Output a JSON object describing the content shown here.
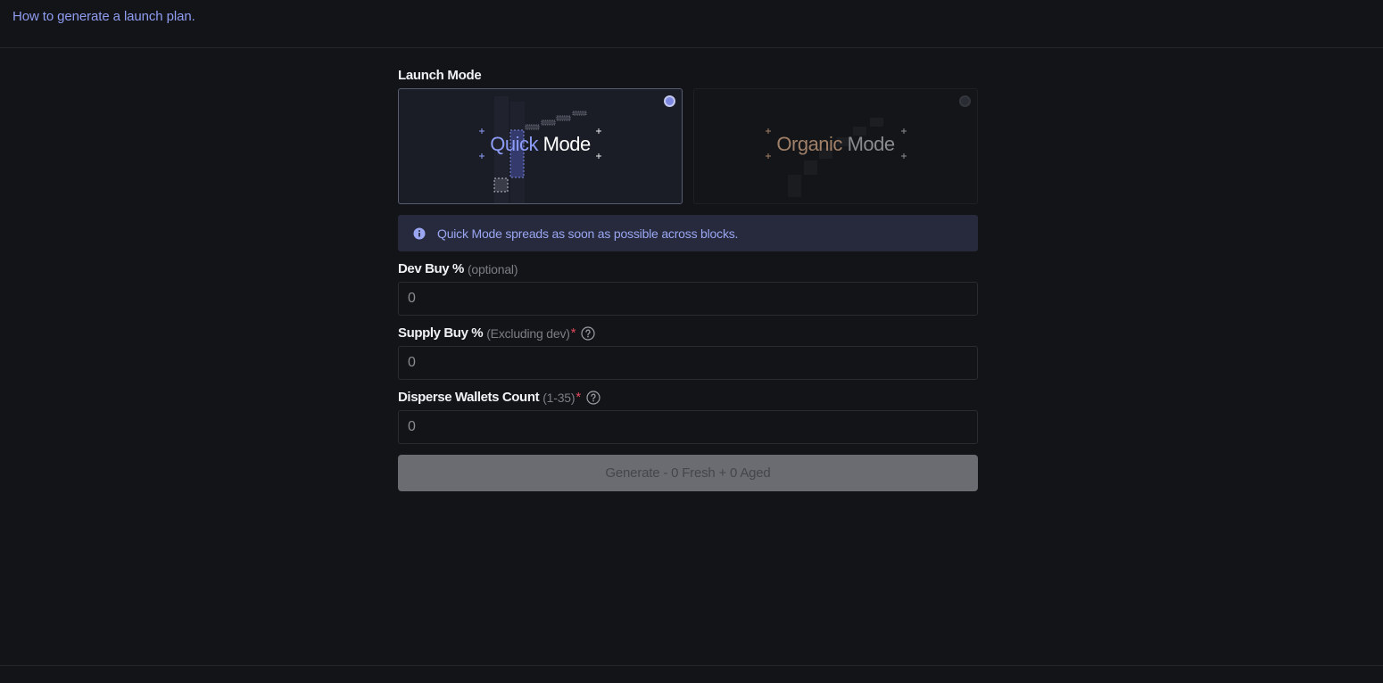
{
  "header": {
    "help_link": "How to generate a launch plan."
  },
  "launch_mode": {
    "label": "Launch Mode",
    "modes": [
      {
        "word1": "Quick",
        "word2": "Mode",
        "selected": true,
        "accent": "#8d9cf6"
      },
      {
        "word1": "Organic",
        "word2": "Mode",
        "selected": false,
        "accent": "#a08068"
      }
    ]
  },
  "info": {
    "icon": "info-icon",
    "text": "Quick Mode spreads as soon as possible across blocks."
  },
  "fields": {
    "dev_buy": {
      "label": "Dev Buy %",
      "hint": "(optional)",
      "value": "0"
    },
    "supply_buy": {
      "label": "Supply Buy %",
      "hint": "(Excluding dev)",
      "required": "*",
      "value": "0"
    },
    "disperse_wallets": {
      "label": "Disperse Wallets Count",
      "hint": "(1-35)",
      "required": "*",
      "value": "0"
    }
  },
  "generate_button": {
    "label": "Generate - 0 Fresh + 0 Aged",
    "enabled": false
  },
  "colors": {
    "background": "#131417",
    "accent": "#8d9cf6",
    "banner": "#262a3c",
    "required": "#e0495e",
    "button_disabled": "#6b6c71"
  }
}
